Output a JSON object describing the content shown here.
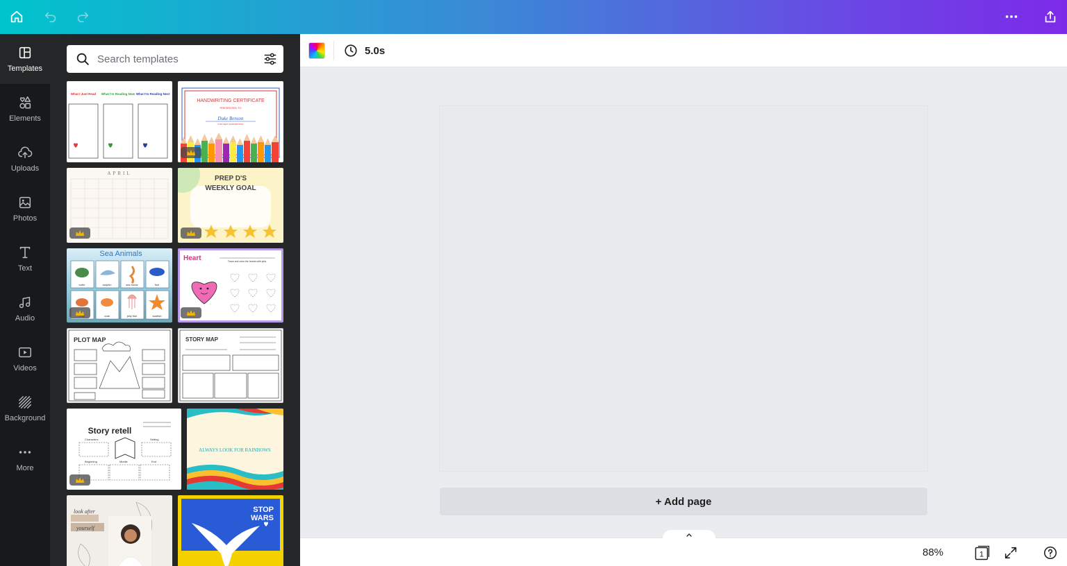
{
  "search": {
    "placeholder": "Search templates"
  },
  "sidebar": {
    "items": [
      {
        "label": "Templates"
      },
      {
        "label": "Elements"
      },
      {
        "label": "Uploads"
      },
      {
        "label": "Photos"
      },
      {
        "label": "Text"
      },
      {
        "label": "Audio"
      },
      {
        "label": "Videos"
      },
      {
        "label": "Background"
      },
      {
        "label": "More"
      }
    ]
  },
  "toolbar": {
    "duration": "5.0s"
  },
  "templates": {
    "reading": {
      "col1": "What I Just Read",
      "col2": "What I'm Reading Now",
      "col3": "What I'm Reading Next"
    },
    "certificate": {
      "title": "HANDWRITING CERTIFICATE",
      "sub": "PRESENTED TO",
      "name": "Duke Benson",
      "note": "FOR NEAT HANDWRITING"
    },
    "calendar": {
      "month": "APRIL"
    },
    "weekly_goal": {
      "line1": "PREP D'S",
      "line2": "WEEKLY GOAL"
    },
    "sea_animals": {
      "title": "Sea Animals",
      "labels": [
        "turtle",
        "dolphin",
        "sea horse",
        "fish",
        "crab",
        "crab",
        "jelly fish",
        "starfish"
      ]
    },
    "heart": {
      "title": "Heart",
      "instruction": "Trace and color the hearts with pink."
    },
    "plot_map": {
      "title": "PLOT MAP"
    },
    "story_map": {
      "title": "STORY MAP"
    },
    "story_retell": {
      "title": "Story retell",
      "labels": [
        "Characters",
        "Setting",
        "Beginning",
        "Middle",
        "End"
      ]
    },
    "rainbows": {
      "text": "ALWAYS LOOK FOR RAINBOWS"
    },
    "look_after": {
      "line1": "look after",
      "line2": "yourself"
    },
    "stop_wars": {
      "line1": "STOP",
      "line2": "WARS"
    }
  },
  "canvas": {
    "add_page": "+ Add page"
  },
  "footer": {
    "zoom": "88%",
    "page_count": "1"
  },
  "colors": {
    "rail_bg": "#18191b",
    "panel_bg": "#252627",
    "gradient_start": "#00c4cc",
    "gradient_end": "#7d2ae8",
    "workspace": "#ebecf0"
  }
}
